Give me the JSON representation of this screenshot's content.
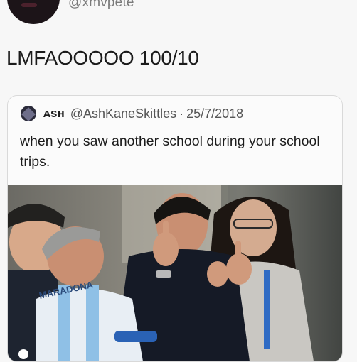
{
  "poster": {
    "handle": "@xmvpete"
  },
  "tweet": {
    "text": "LMFAOOOOO 100/10"
  },
  "quoted_tweet": {
    "display_name": "ᴀsʜ",
    "handle": "@AshKaneSkittles",
    "separator": "·",
    "date": "25/7/2018",
    "text": "when you saw another school during your school trips."
  },
  "photo": {
    "jersey_text": "MARADONA"
  }
}
